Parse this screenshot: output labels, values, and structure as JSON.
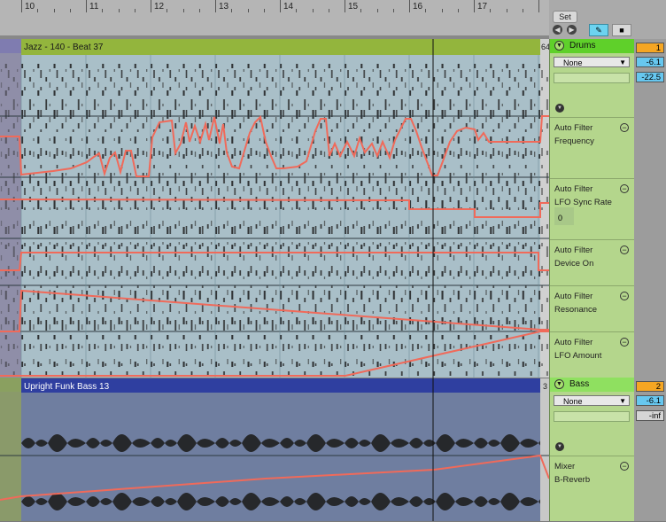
{
  "ruler": {
    "bars": [
      "10",
      "11",
      "12",
      "13",
      "14",
      "15",
      "16",
      "17"
    ]
  },
  "clips": {
    "drums_clip": {
      "title": "Jazz - 140 - Beat 37",
      "end_marker": "64"
    },
    "bass_clip": {
      "title": "Upright Funk Bass 13",
      "end_marker": "3"
    }
  },
  "transport": {
    "set_label": "Set",
    "prev_icon": "left-arrow-icon",
    "next_icon": "right-arrow-icon",
    "draw_icon": "pencil-icon",
    "lock_icon": "lock-icon"
  },
  "tracks": {
    "drums": {
      "name": "Drums",
      "device_chooser": "None",
      "number": "1",
      "volume": "-6.1",
      "pan": "-22.5",
      "automation": [
        {
          "device": "Auto Filter",
          "param": "Frequency"
        },
        {
          "device": "Auto Filter",
          "param": "LFO Sync Rate",
          "value": "0"
        },
        {
          "device": "Auto Filter",
          "param": "Device On"
        },
        {
          "device": "Auto Filter",
          "param": "Resonance"
        },
        {
          "device": "Auto Filter",
          "param": "LFO Amount"
        }
      ]
    },
    "bass": {
      "name": "Bass",
      "device_chooser": "None",
      "number": "2",
      "volume": "-6.1",
      "send": "-inf",
      "automation": [
        {
          "device": "Mixer",
          "param": "B-Reverb"
        }
      ]
    }
  },
  "colors": {
    "track_header_green": "#5fd02a",
    "drum_clip_header": "#93b53d",
    "bass_clip_header": "#2f3fa0",
    "automation_line": "#f06a5a",
    "clip_number_orange": "#f5a623",
    "value_blue": "#67c7ef"
  }
}
